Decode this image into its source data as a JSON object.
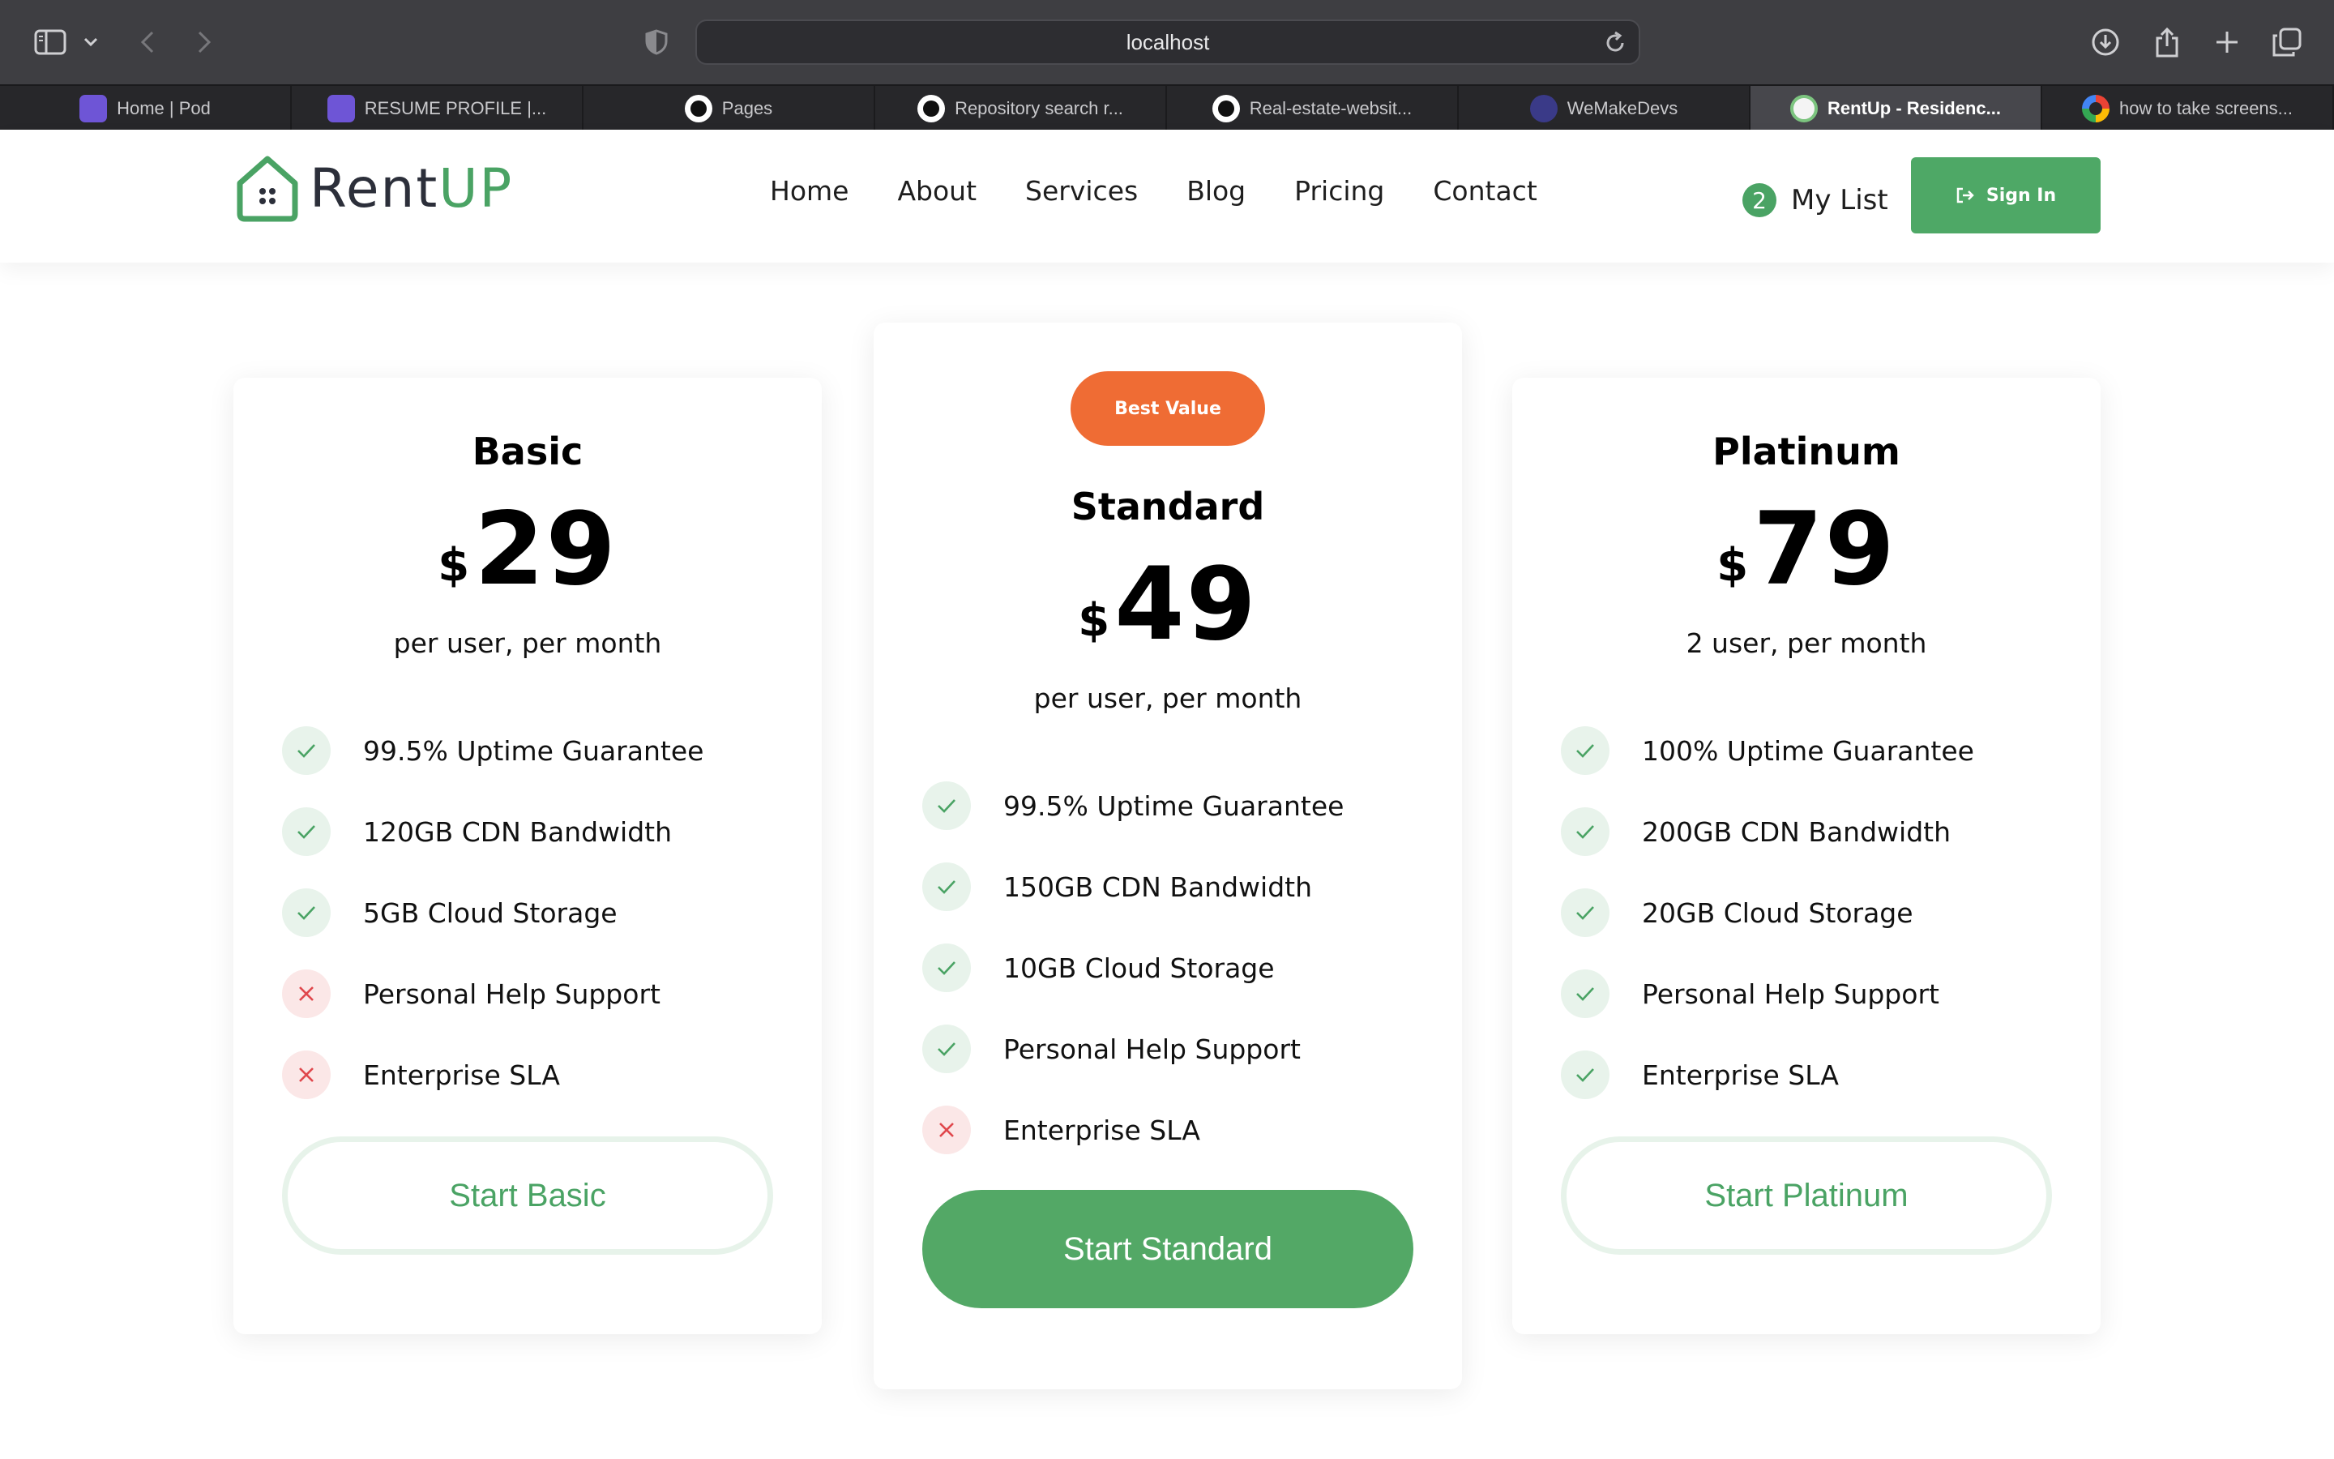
{
  "browser": {
    "url": "localhost",
    "tabs": [
      {
        "label": "Home | Pod",
        "icon": "pod-favicon"
      },
      {
        "label": "RESUME PROFILE |...",
        "icon": "pod-favicon"
      },
      {
        "label": "Pages",
        "icon": "github-favicon"
      },
      {
        "label": "Repository search r...",
        "icon": "github-favicon"
      },
      {
        "label": "Real-estate-websit...",
        "icon": "github-favicon"
      },
      {
        "label": "WeMakeDevs",
        "icon": "wemakedevs-favicon"
      },
      {
        "label": "RentUp - Residenc...",
        "icon": "rentup-favicon",
        "active": true
      },
      {
        "label": "how to take screens...",
        "icon": "google-favicon"
      }
    ]
  },
  "header": {
    "brand_part1": "Rent",
    "brand_part2": "UP",
    "nav": [
      "Home",
      "About",
      "Services",
      "Blog",
      "Pricing",
      "Contact"
    ],
    "mylist_count": "2",
    "mylist_label": "My List",
    "signin_label": "Sign In"
  },
  "plans": [
    {
      "name": "Basic",
      "currency": "$",
      "price": "29",
      "per": "per user, per month",
      "features": [
        {
          "text": "99.5% Uptime Guarantee",
          "included": true
        },
        {
          "text": "120GB CDN Bandwidth",
          "included": true
        },
        {
          "text": "5GB Cloud Storage",
          "included": true
        },
        {
          "text": "Personal Help Support",
          "included": false
        },
        {
          "text": "Enterprise SLA",
          "included": false
        }
      ],
      "cta": "Start Basic"
    },
    {
      "badge": "Best Value",
      "name": "Standard",
      "currency": "$",
      "price": "49",
      "per": "per user, per month",
      "features": [
        {
          "text": "99.5% Uptime Guarantee",
          "included": true
        },
        {
          "text": "150GB CDN Bandwidth",
          "included": true
        },
        {
          "text": "10GB Cloud Storage",
          "included": true
        },
        {
          "text": "Personal Help Support",
          "included": true
        },
        {
          "text": "Enterprise SLA",
          "included": false
        }
      ],
      "cta": "Start Standard"
    },
    {
      "name": "Platinum",
      "currency": "$",
      "price": "79",
      "per": "2 user, per month",
      "features": [
        {
          "text": "100% Uptime Guarantee",
          "included": true
        },
        {
          "text": "200GB CDN Bandwidth",
          "included": true
        },
        {
          "text": "20GB Cloud Storage",
          "included": true
        },
        {
          "text": "Personal Help Support",
          "included": true
        },
        {
          "text": "Enterprise SLA",
          "included": true
        }
      ],
      "cta": "Start Platinum"
    }
  ],
  "colors": {
    "accent_green": "#4aa364",
    "badge_orange": "#ef6c34",
    "check_bg": "#e8f3eb",
    "cross_bg": "#fbe7e7",
    "cross_red": "#e0474c"
  }
}
